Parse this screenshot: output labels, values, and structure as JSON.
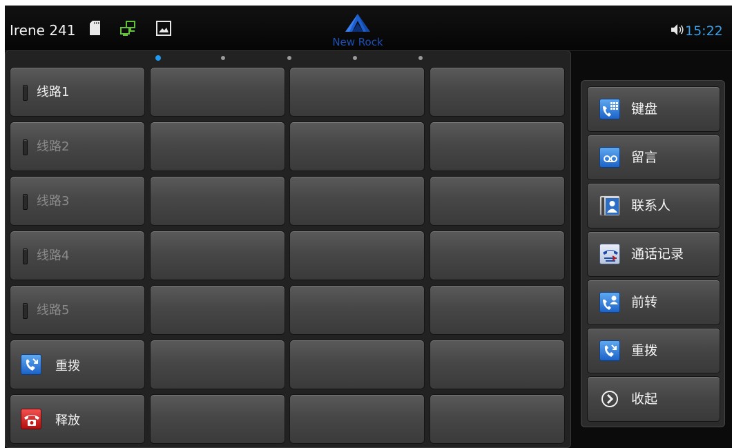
{
  "status_bar": {
    "account": "Irene 241",
    "logo_text": "New Rock",
    "time": "15:22",
    "icons": [
      "sdcard-icon",
      "network-icon",
      "image-icon",
      "speaker-icon"
    ]
  },
  "pages": {
    "count": 5,
    "current": 1
  },
  "line_keys": [
    {
      "label": "线路1",
      "active": true
    },
    {
      "label": "线路2",
      "active": false
    },
    {
      "label": "线路3",
      "active": false
    },
    {
      "label": "线路4",
      "active": false
    },
    {
      "label": "线路5",
      "active": false
    }
  ],
  "action_keys": [
    {
      "label": "重拨",
      "icon": "redial-icon"
    },
    {
      "label": "释放",
      "icon": "release-icon"
    }
  ],
  "side_menu": [
    {
      "label": "键盘",
      "icon": "keypad-icon"
    },
    {
      "label": "留言",
      "icon": "voicemail-icon"
    },
    {
      "label": "联系人",
      "icon": "contacts-icon"
    },
    {
      "label": "通话记录",
      "icon": "call-log-icon"
    },
    {
      "label": "前转",
      "icon": "forward-icon"
    },
    {
      "label": "重拨",
      "icon": "redial-icon"
    },
    {
      "label": "收起",
      "icon": "collapse-icon"
    }
  ],
  "colors": {
    "clock": "#3aa0e6",
    "logo": "#1e4fb5",
    "active_dot": "#1e9bf0",
    "release_icon": "#d42020",
    "blue_icon": "#2f7fde"
  }
}
